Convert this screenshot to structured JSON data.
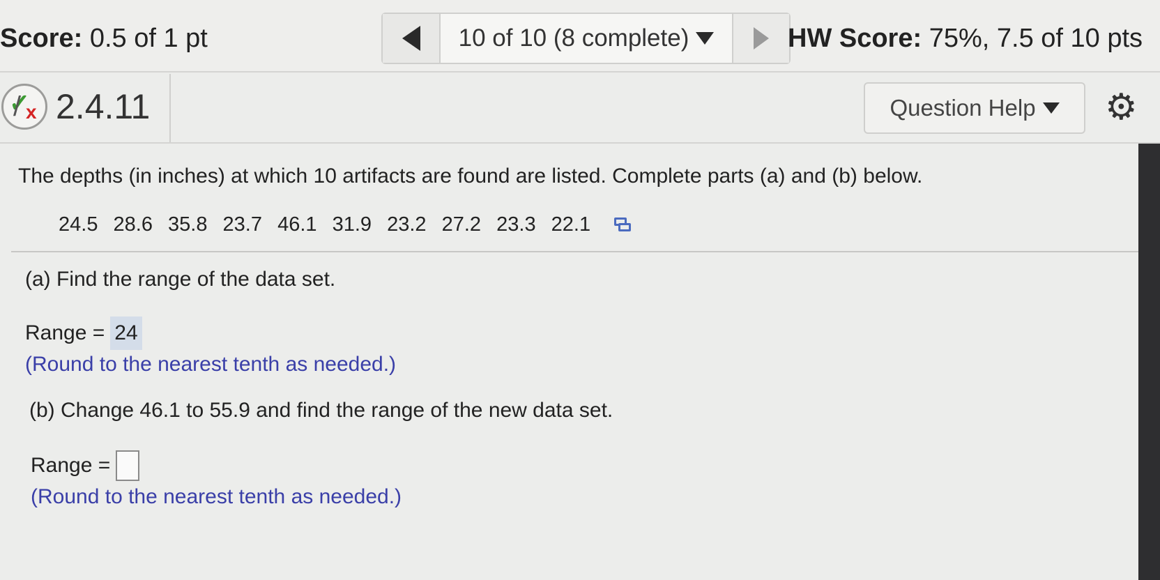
{
  "header": {
    "score_label": "Score:",
    "score_value": "0.5 of 1 pt",
    "nav_label": "10 of 10 (8 complete)",
    "hw_score_label": "HW Score:",
    "hw_score_value": "75%, 7.5 of 10 pts"
  },
  "question": {
    "number": "2.4.11",
    "status_icon": "partial-credit-icon",
    "help_label": "Question Help",
    "settings_icon": "gear-icon"
  },
  "body": {
    "prompt": "The depths (in inches) at which 10 artifacts are found are listed. Complete parts (a) and (b) below.",
    "data_values": [
      "24.5",
      "28.6",
      "35.8",
      "23.7",
      "46.1",
      "31.9",
      "23.2",
      "27.2",
      "23.3",
      "22.1"
    ],
    "part_a": {
      "question": "(a) Find the range of the data set.",
      "range_label": "Range =",
      "answer": "24",
      "hint": "(Round to the nearest tenth as needed.)"
    },
    "part_b": {
      "question": "(b) Change 46.1 to 55.9 and find the range of the new data set.",
      "range_label": "Range =",
      "answer": "",
      "hint": "(Round to the nearest tenth as needed.)"
    }
  },
  "colors": {
    "hint_text": "#3a3fa8",
    "answer_highlight": "#d4dde9",
    "check_green": "#3c9a33",
    "x_red": "#d42424"
  }
}
